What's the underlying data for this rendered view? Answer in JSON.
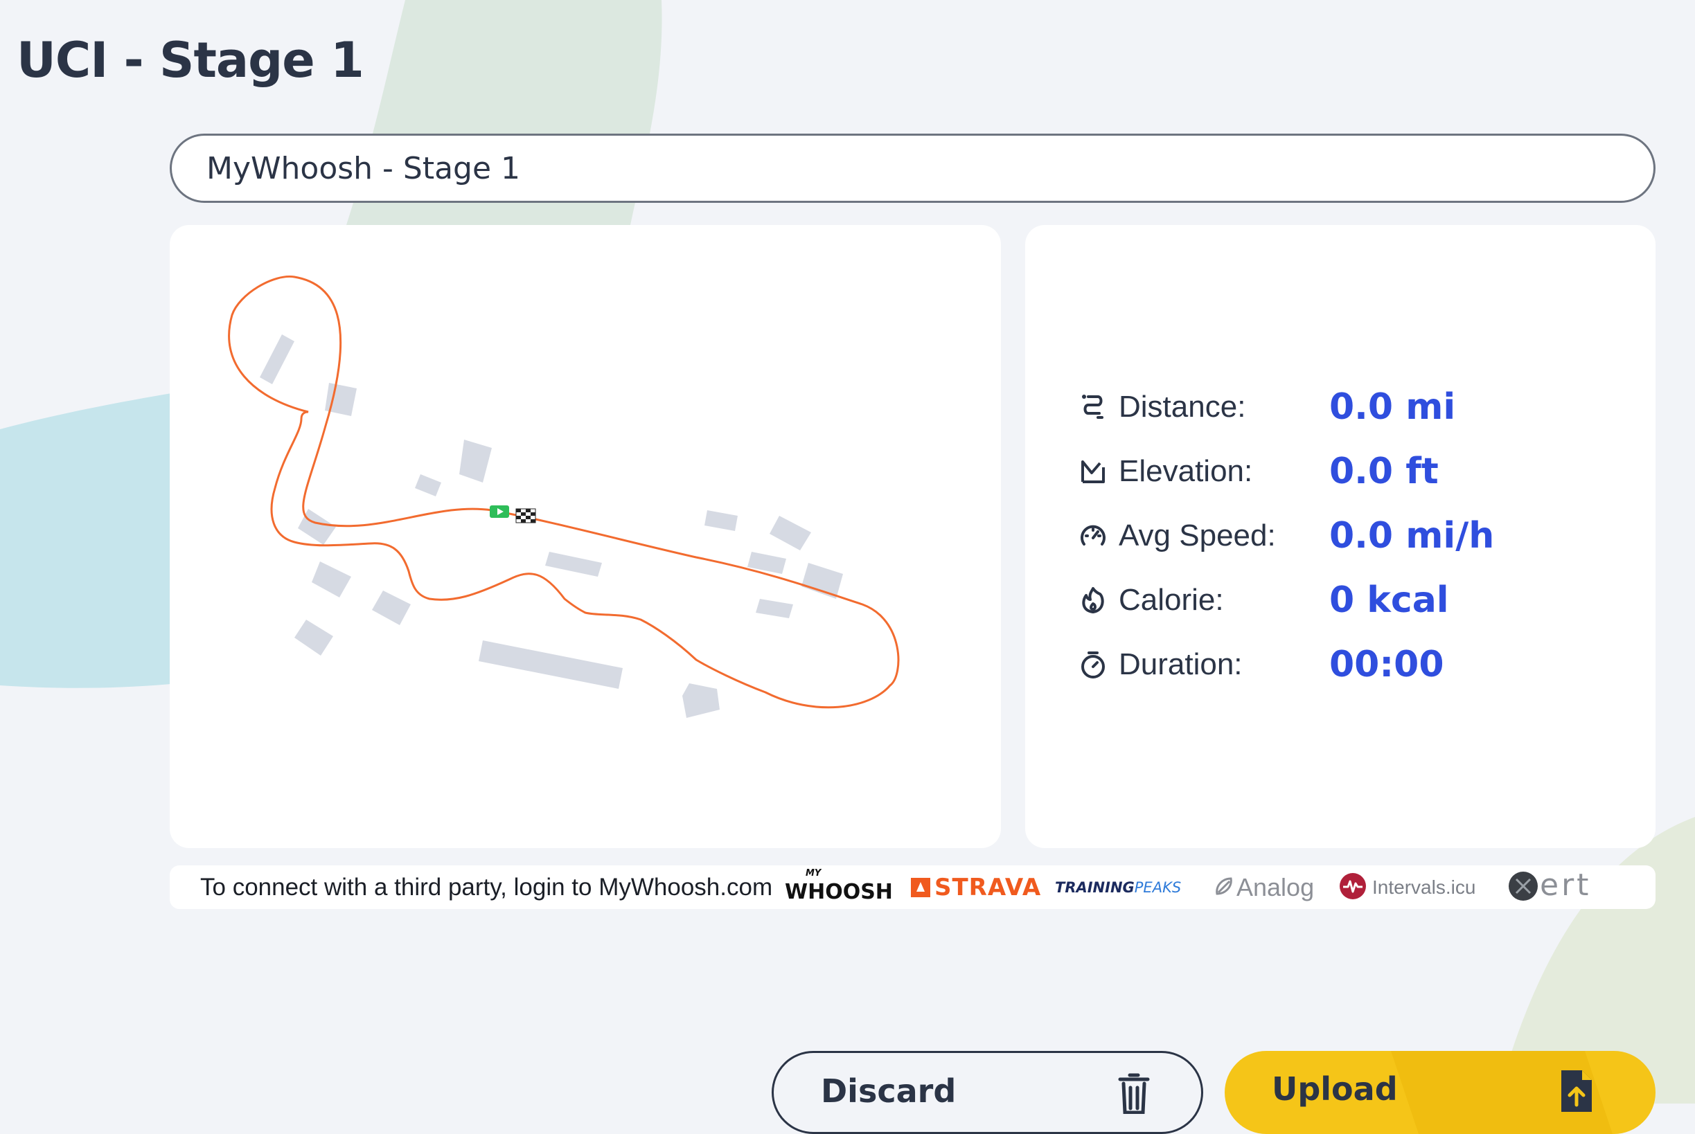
{
  "page": {
    "title": "UCI - Stage 1"
  },
  "activity_name_input": {
    "value": "MyWhoosh - Stage 1"
  },
  "stats": [
    {
      "icon": "route-icon",
      "label": "Distance:",
      "value": "0.0 mi"
    },
    {
      "icon": "elevation-icon",
      "label": "Elevation:",
      "value": "0.0 ft"
    },
    {
      "icon": "speedometer-icon",
      "label": "Avg Speed:",
      "value": "0.0 mi/h"
    },
    {
      "icon": "flame-icon",
      "label": "Calorie:",
      "value": "0 kcal"
    },
    {
      "icon": "stopwatch-icon",
      "label": "Duration:",
      "value": "00:00"
    }
  ],
  "third_party": {
    "text": "To connect with a third party, login to MyWhoosh.com",
    "logos": {
      "mywhoosh": "WHOOSH",
      "mywhoosh_small": "MY",
      "strava": "STRAVA",
      "trainingpeaks_a": "TRAINING",
      "trainingpeaks_b": "PEAKS",
      "analog": "Analog",
      "intervals": "Intervals.icu",
      "xert": "ert"
    }
  },
  "buttons": {
    "discard": "Discard",
    "upload": "Upload"
  },
  "colors": {
    "route": "#f26b2f",
    "accent_value": "#2f4ede",
    "upload_button": "#f5c518",
    "strava": "#f05a1e"
  }
}
